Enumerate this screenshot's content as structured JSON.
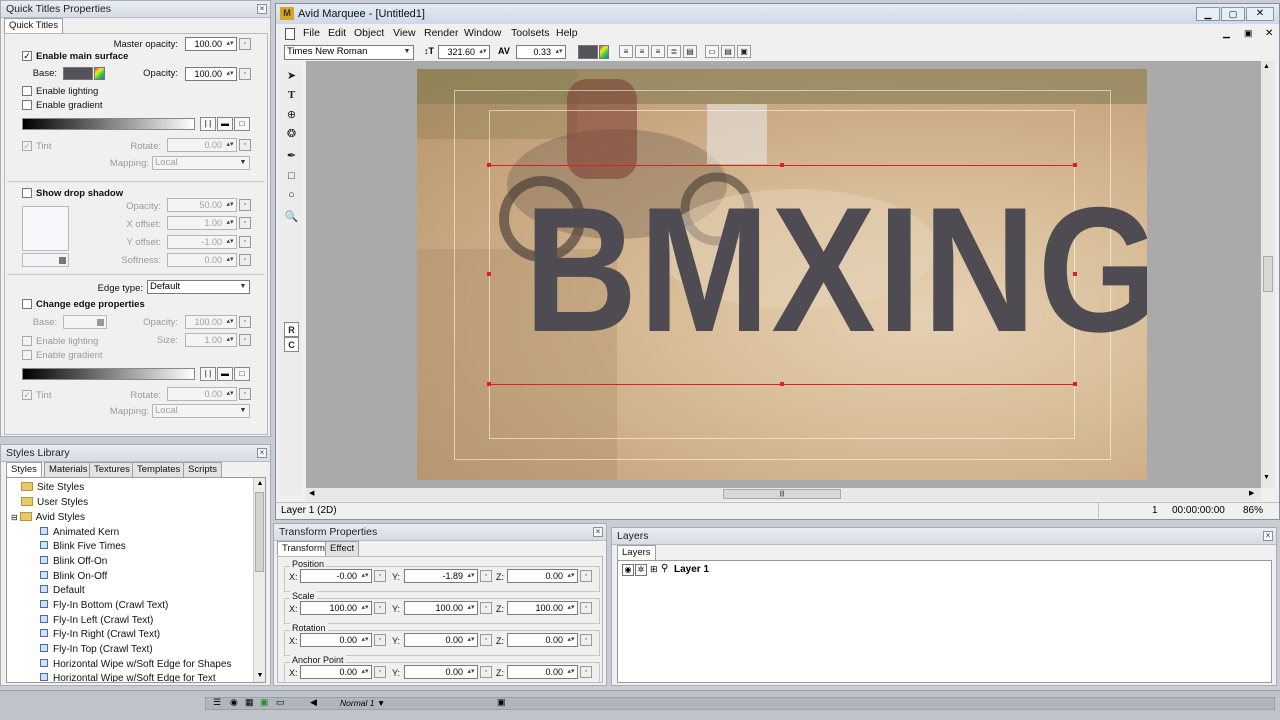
{
  "qtp": {
    "title": "Quick Titles Properties",
    "tab": "Quick Titles",
    "master_opacity_label": "Master opacity:",
    "master_opacity": "100.00",
    "enable_main_surface": "Enable main surface",
    "base_label": "Base:",
    "opacity_label": "Opacity:",
    "opacity": "100.00",
    "enable_lighting": "Enable lighting",
    "enable_gradient": "Enable gradient",
    "tint": "Tint",
    "rotate": "Rotate:",
    "rotate_value": "0.00",
    "mapping": "Mapping:",
    "mapping_value": "Local",
    "show_drop_shadow": "Show drop shadow",
    "shadow_opacity_label": "Opacity:",
    "shadow_opacity": "50.00",
    "x_offset_label": "X offset:",
    "x_offset": "1.00",
    "y_offset_label": "Y offset:",
    "y_offset": "-1.00",
    "softness_label": "Softness:",
    "softness": "0.00",
    "edge_type_label": "Edge type:",
    "edge_type": "Default",
    "change_edge": "Change edge properties",
    "edge_base_label": "Base:",
    "edge_opacity_label": "Opacity:",
    "edge_opacity": "100.00",
    "size_label": "Size:",
    "size": "1.00",
    "edge_enable_lighting": "Enable lighting",
    "edge_enable_gradient": "Enable gradient",
    "edge_tint": "Tint",
    "edge_rotate": "Rotate:",
    "edge_rotate_value": "0.00",
    "edge_mapping": "Mapping:",
    "edge_mapping_value": "Local"
  },
  "styles": {
    "title": "Styles Library",
    "tabs": [
      "Styles",
      "Materials",
      "Textures",
      "Templates",
      "Scripts"
    ],
    "folders": [
      "Site Styles",
      "User Styles",
      "Avid Styles"
    ],
    "items": [
      "Animated Kern",
      "Blink Five Times",
      "Blink Off-On",
      "Blink On-Off",
      "Default",
      "Fly-In Bottom (Crawl Text)",
      "Fly-In Left (Crawl Text)",
      "Fly-In Right (Crawl Text)",
      "Fly-In Top (Crawl Text)",
      "Horizontal Wipe w/Soft Edge for Shapes",
      "Horizontal Wipe w/Soft Edge for Text"
    ]
  },
  "app": {
    "title": "Avid Marquee - [Untitled1]",
    "menu": [
      "File",
      "Edit",
      "Object",
      "View",
      "Render",
      "Window",
      "Toolsets",
      "Help"
    ],
    "font": "Times New Roman",
    "font_size": "321.60",
    "kerning": "0.33",
    "title_text": "BMXING",
    "status_layer": "Layer 1 (2D)",
    "status_frame": "1",
    "status_time": "00:00:00:00",
    "status_zoom": "86%",
    "mode": "Normal 1"
  },
  "transform": {
    "title": "Transform Properties",
    "tabs": [
      "Transform",
      "Effect"
    ],
    "position": {
      "label": "Position",
      "x": "-0.00",
      "y": "-1.89",
      "z": "0.00"
    },
    "scale": {
      "label": "Scale",
      "x": "100.00",
      "y": "100.00",
      "z": "100.00"
    },
    "rotation": {
      "label": "Rotation",
      "x": "0.00",
      "y": "0.00",
      "z": "0.00"
    },
    "anchor": {
      "label": "Anchor Point",
      "x": "0.00",
      "y": "0.00",
      "z": "0.00"
    },
    "x": "X:",
    "y": "Y:",
    "z": "Z:"
  },
  "layers": {
    "title": "Layers",
    "tab": "Layers",
    "row": "Layer 1"
  },
  "colors": {
    "text_fill": "#4f4b52",
    "accent_red": "#e02020"
  }
}
